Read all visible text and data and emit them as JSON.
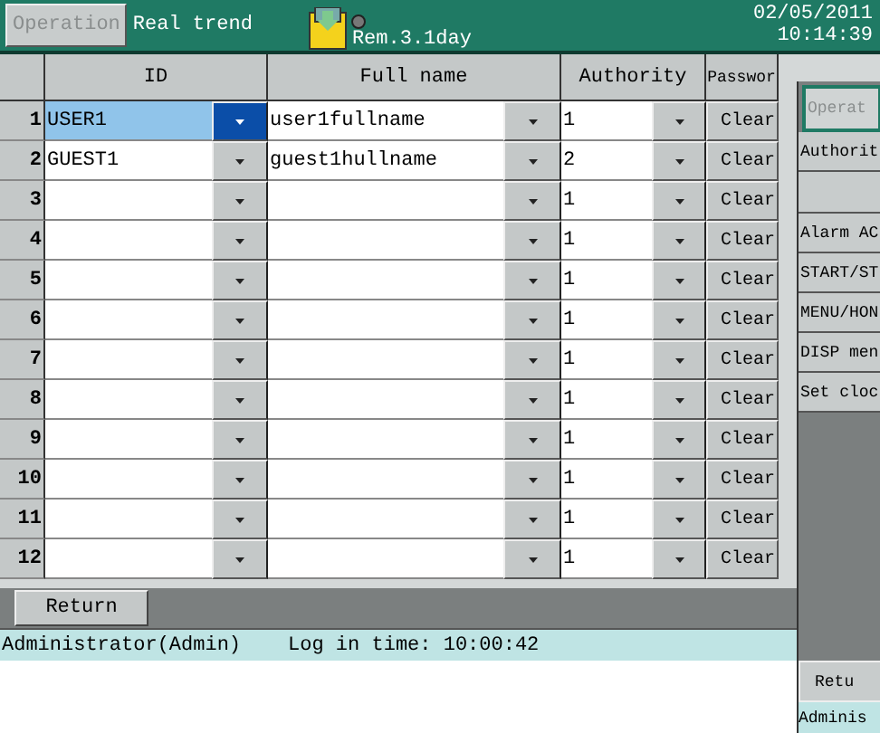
{
  "header": {
    "operation_button": {
      "label": "Operation",
      "disabled": true
    },
    "screen_title": "Real trend",
    "storage": {
      "remaining": "Rem.3.1day"
    },
    "date": "02/05/2011",
    "time": "10:14:39"
  },
  "table": {
    "columns": [
      "ID",
      "Full name",
      "Authority",
      "Passwor"
    ],
    "rows": [
      {
        "number": "1",
        "id": "USER1",
        "full_name": "user1fullname",
        "authority": "1",
        "action": "Clear",
        "selected": true
      },
      {
        "number": "2",
        "id": "GUEST1",
        "full_name": "guest1hullname",
        "authority": "2",
        "action": "Clear",
        "selected": false
      },
      {
        "number": "3",
        "authority": "1",
        "action": "Clear",
        "selected": false
      },
      {
        "number": "4",
        "authority": "1",
        "action": "Clear",
        "selected": false
      },
      {
        "number": "5",
        "authority": "1",
        "action": "Clear",
        "selected": false
      },
      {
        "number": "6",
        "authority": "1",
        "action": "Clear",
        "selected": false
      },
      {
        "number": "7",
        "authority": "1",
        "action": "Clear",
        "selected": false
      },
      {
        "number": "8",
        "authority": "1",
        "action": "Clear",
        "selected": false
      },
      {
        "number": "9",
        "authority": "1",
        "action": "Clear",
        "selected": false
      },
      {
        "number": "10",
        "authority": "1",
        "action": "Clear",
        "selected": false
      },
      {
        "number": "11",
        "authority": "1",
        "action": "Clear",
        "selected": false
      },
      {
        "number": "12",
        "authority": "1",
        "action": "Clear",
        "selected": false
      }
    ]
  },
  "return_button": "Return",
  "status_bar": {
    "user": "Administrator(Admin)",
    "login": "Log in time: 10:00:42"
  },
  "overlay_window": {
    "operation_button": {
      "label": "Operat",
      "disabled": true
    },
    "items": [
      {
        "label": "Authorit"
      },
      {
        "label": "Alarm AC"
      },
      {
        "label": "START/ST"
      },
      {
        "label": "MENU/HON"
      },
      {
        "label": "DISP men"
      },
      {
        "label": "Set cloc"
      }
    ],
    "return_button": "Retu",
    "status": "Adminis"
  }
}
